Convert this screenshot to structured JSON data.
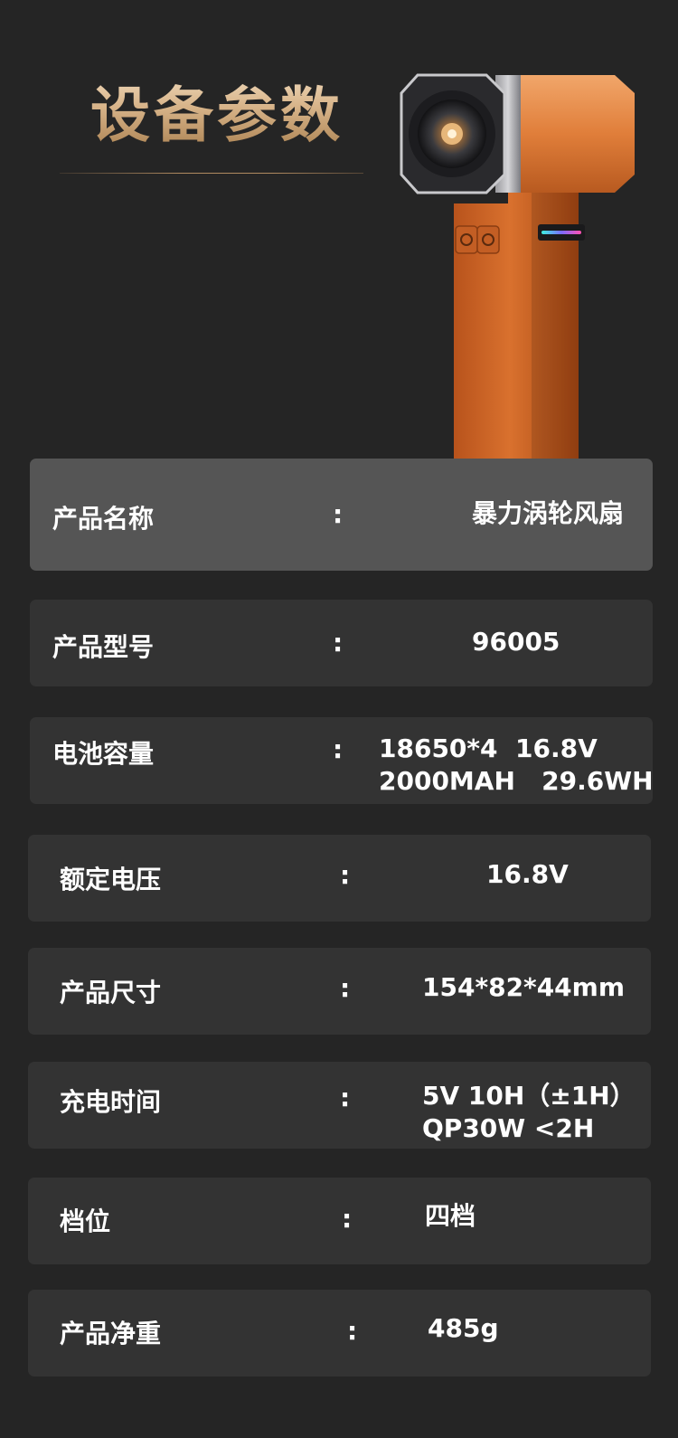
{
  "header": {
    "title": "设备参数"
  },
  "specs": [
    {
      "label": "产品名称",
      "colon": ":",
      "value": "暴力涡轮风扇"
    },
    {
      "label": "产品型号",
      "colon": ":",
      "value": "96005"
    },
    {
      "label": "电池容量",
      "colon": ":",
      "value_line1": "18650*4  16.8V",
      "value_line2": "2000MAH   29.6WH"
    },
    {
      "label": "额定电压",
      "colon": ":",
      "value": "16.8V"
    },
    {
      "label": "产品尺寸",
      "colon": ":",
      "value": "154*82*44mm"
    },
    {
      "label": "充电时间",
      "colon": ":",
      "value_line1": "5V 10H（±1H）",
      "value_line2": "QP30W <2H"
    },
    {
      "label": "档位",
      "colon": ":",
      "value": "四档"
    },
    {
      "label": "产品净重",
      "colon": ":",
      "value": "485g"
    }
  ],
  "colors": {
    "background": "#252525",
    "row": "#333333",
    "row_highlight": "#555555",
    "title_gold": "#d8b48a",
    "product_orange": "#d3692a"
  },
  "icons": [
    "power-icon",
    "fan-icon"
  ]
}
